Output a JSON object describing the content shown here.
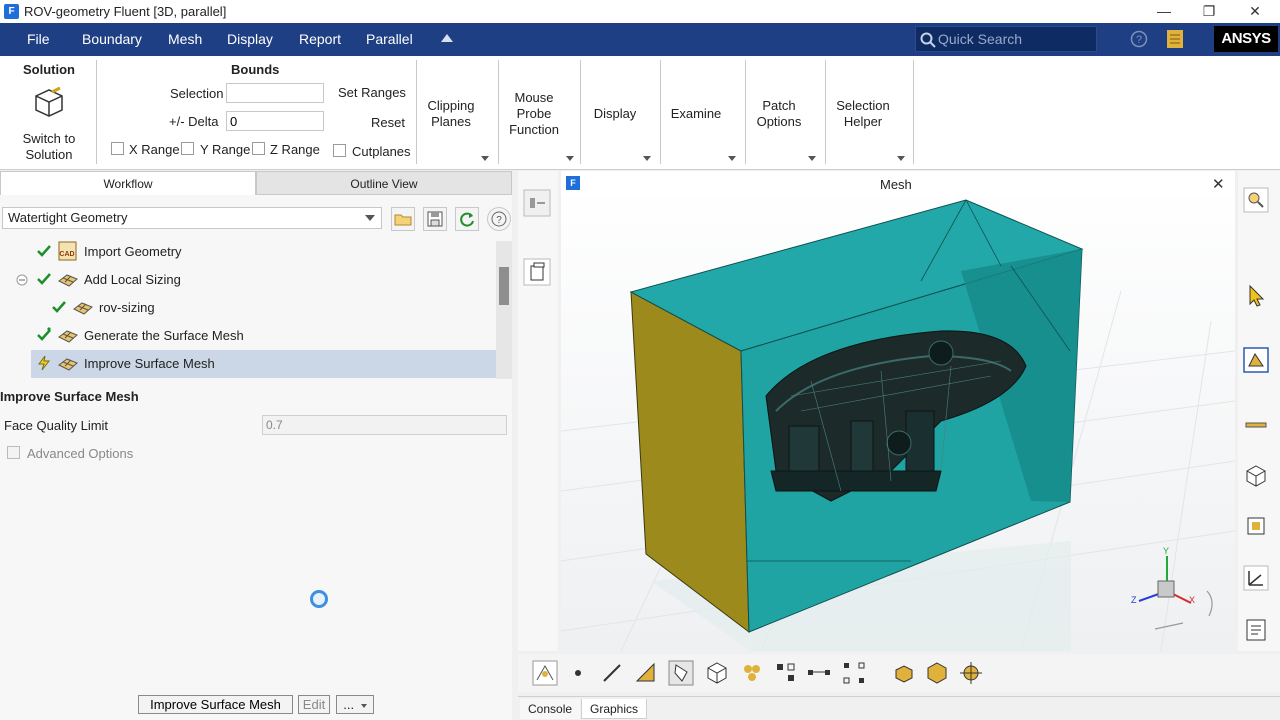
{
  "window": {
    "title": "ROV-geometry Fluent  [3D, parallel]",
    "app_icon": "F",
    "controls": [
      "—",
      "❐",
      "✕"
    ]
  },
  "menubar": {
    "items": [
      "File",
      "Boundary",
      "Mesh",
      "Display",
      "Report",
      "Parallel"
    ],
    "search_placeholder": "Quick Search",
    "logo": "ANSYS"
  },
  "ribbon": {
    "solution": {
      "heading": "Solution",
      "button_line1": "Switch to",
      "button_line2": "Solution"
    },
    "bounds": {
      "heading": "Bounds",
      "selection_label": "Selection",
      "selection_value": "",
      "delta_label": "+/- Delta",
      "delta_value": "0",
      "set_ranges": "Set Ranges",
      "reset": "Reset",
      "x_range": "X Range",
      "y_range": "Y Range",
      "z_range": "Z Range",
      "cutplanes": "Cutplanes"
    },
    "groups": {
      "clipping_1": "Clipping",
      "clipping_2": "Planes",
      "mouse_1": "Mouse",
      "mouse_2": "Probe",
      "mouse_3": "Function",
      "display": "Display",
      "examine": "Examine",
      "patch_1": "Patch",
      "patch_2": "Options",
      "selection_1": "Selection",
      "selection_2": "Helper"
    }
  },
  "left": {
    "tabs": {
      "workflow": "Workflow",
      "outline": "Outline View"
    },
    "workflow_type": "Watertight Geometry",
    "tree": [
      {
        "label": "Import Geometry"
      },
      {
        "label": "Add Local Sizing"
      },
      {
        "label": "rov-sizing"
      },
      {
        "label": "Generate the Surface Mesh"
      },
      {
        "label": "Improve Surface Mesh"
      }
    ],
    "task": {
      "title": "Improve Surface Mesh",
      "face_quality_label": "Face Quality Limit",
      "face_quality_value": "0.7",
      "advanced_options": "Advanced Options"
    },
    "buttons": {
      "primary": "Improve Surface Mesh",
      "edit": "Edit",
      "more": "..."
    }
  },
  "graphics": {
    "title": "Mesh",
    "close": "✕",
    "axes": {
      "x": "X",
      "y": "Y",
      "z": "Z"
    }
  },
  "bottom_tabs": [
    "Console",
    "Graphics"
  ],
  "colors": {
    "menubar_bg": "#1f3f84",
    "domain_teal": "#1fa5a5",
    "domain_olive": "#9c8a1c",
    "selected_row": "#cbd6e6",
    "check_green": "#1a8f2a"
  }
}
